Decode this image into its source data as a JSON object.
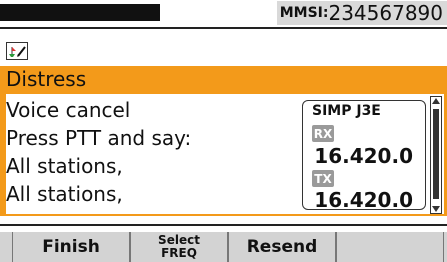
{
  "mmsi": {
    "label": "MMSI:",
    "value": "234567890"
  },
  "status_icon": "vessel-edit-icon",
  "panel": {
    "title": "Distress"
  },
  "message": {
    "lines": [
      "Voice cancel",
      "Press PTT and say:",
      "All stations,",
      "All stations,"
    ]
  },
  "radio": {
    "mode": "SIMP J3E",
    "rx_label": "RX",
    "rx_freq": "16.420.0",
    "tx_label": "TX",
    "tx_freq": "16.420.0"
  },
  "softkeys": {
    "finish": "Finish",
    "select_line1": "Select",
    "select_line2": "FREQ",
    "resend": "Resend"
  },
  "colors": {
    "accent": "#f39a1a",
    "softkey_bg": "#d3d3d3",
    "badge_bg": "#9a9a9a"
  }
}
